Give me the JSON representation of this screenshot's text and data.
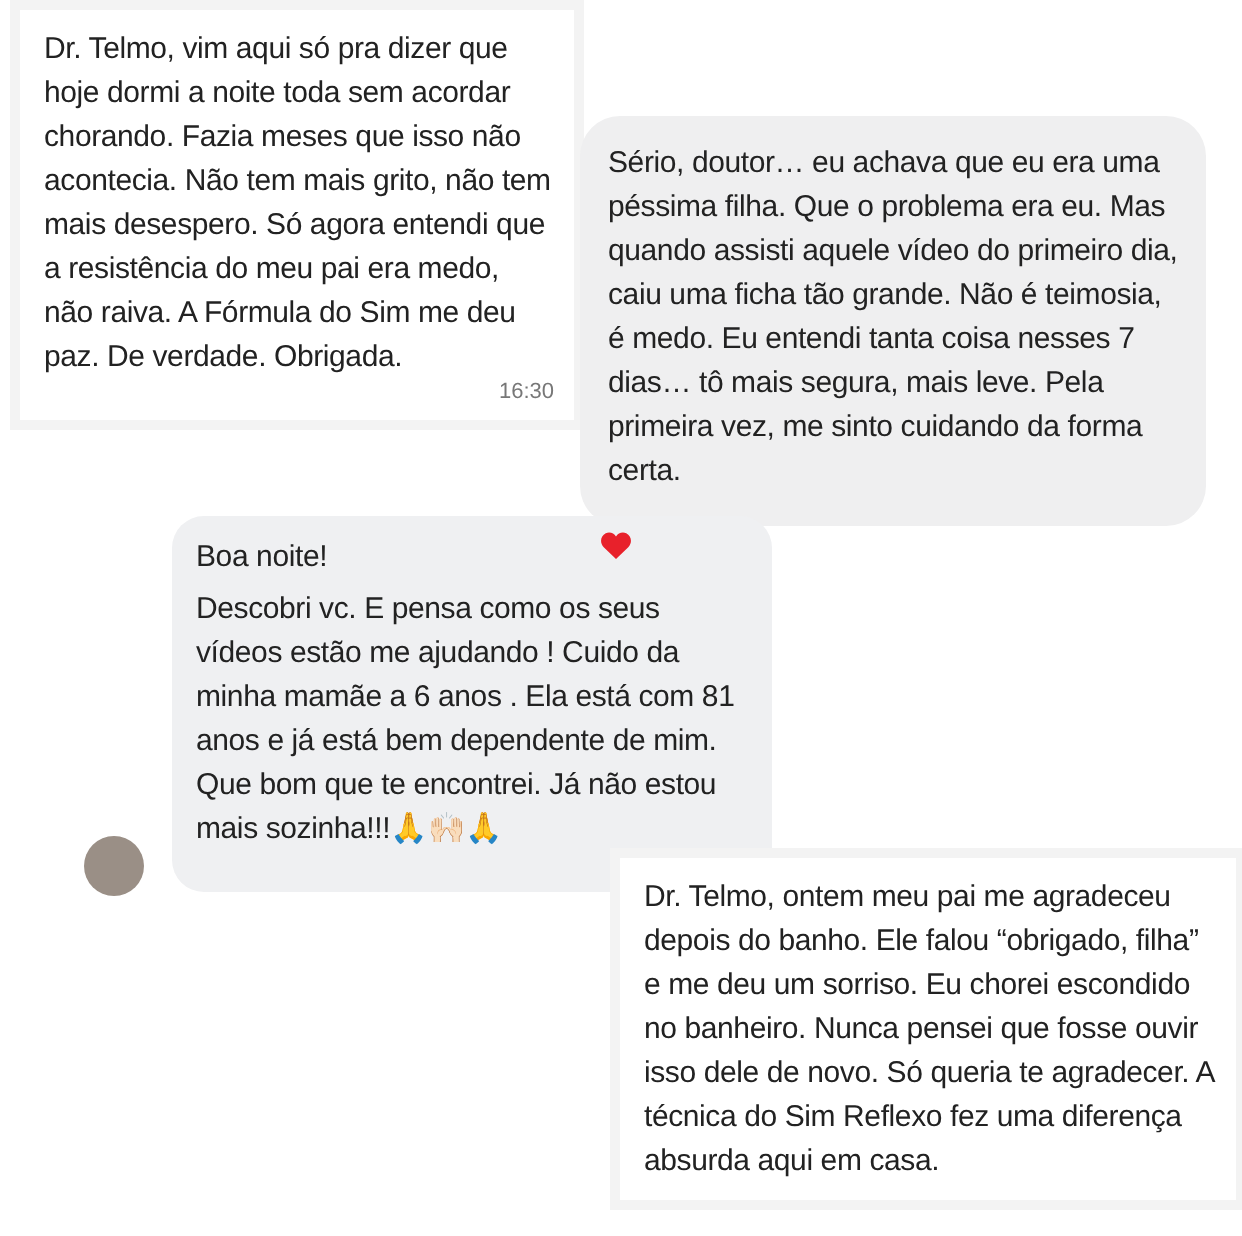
{
  "messages": [
    {
      "kind": "whatsapp",
      "text": "Dr. Telmo, vim aqui só pra dizer que hoje dormi a noite toda sem acordar chorando. Fazia meses que isso não acontecia. Não tem mais grito, não tem mais desespero. Só agora entendi que a resistência do meu pai era medo, não raiva. A Fórmula do Sim me deu paz. De verdade. Obrigada.",
      "time": "16:30"
    },
    {
      "kind": "instagram",
      "text": "Sério, doutor… eu achava que eu era uma péssima filha. Que o problema era eu. Mas quando assisti aquele vídeo do primeiro dia, caiu uma ficha tão grande. Não é teimosia, é medo. Eu entendi tanta coisa nesses 7 dias… tô mais segura, mais leve. Pela primeira vez, me sinto cuidando da forma certa.",
      "reacted": true
    },
    {
      "kind": "facebook",
      "greeting": "Boa noite!",
      "text": "Descobri vc. E pensa como os seus vídeos estão me ajudando ! Cuido da minha mamãe a 6 anos . Ela está com 81 anos e já está bem dependente de mim. Que bom que te encontrei. Já não estou mais sozinha!!!🙏🙌🏻🙏"
    },
    {
      "kind": "whatsapp",
      "text": "Dr. Telmo, ontem meu pai me agradeceu depois do banho. Ele falou “obrigado, filha” e me deu um sorriso. Eu chorei escondido no banheiro. Nunca pensei que fosse ouvir isso dele de novo. Só queria te agradecer. A técnica do Sim Reflexo fez uma diferença absurda aqui em casa."
    }
  ]
}
